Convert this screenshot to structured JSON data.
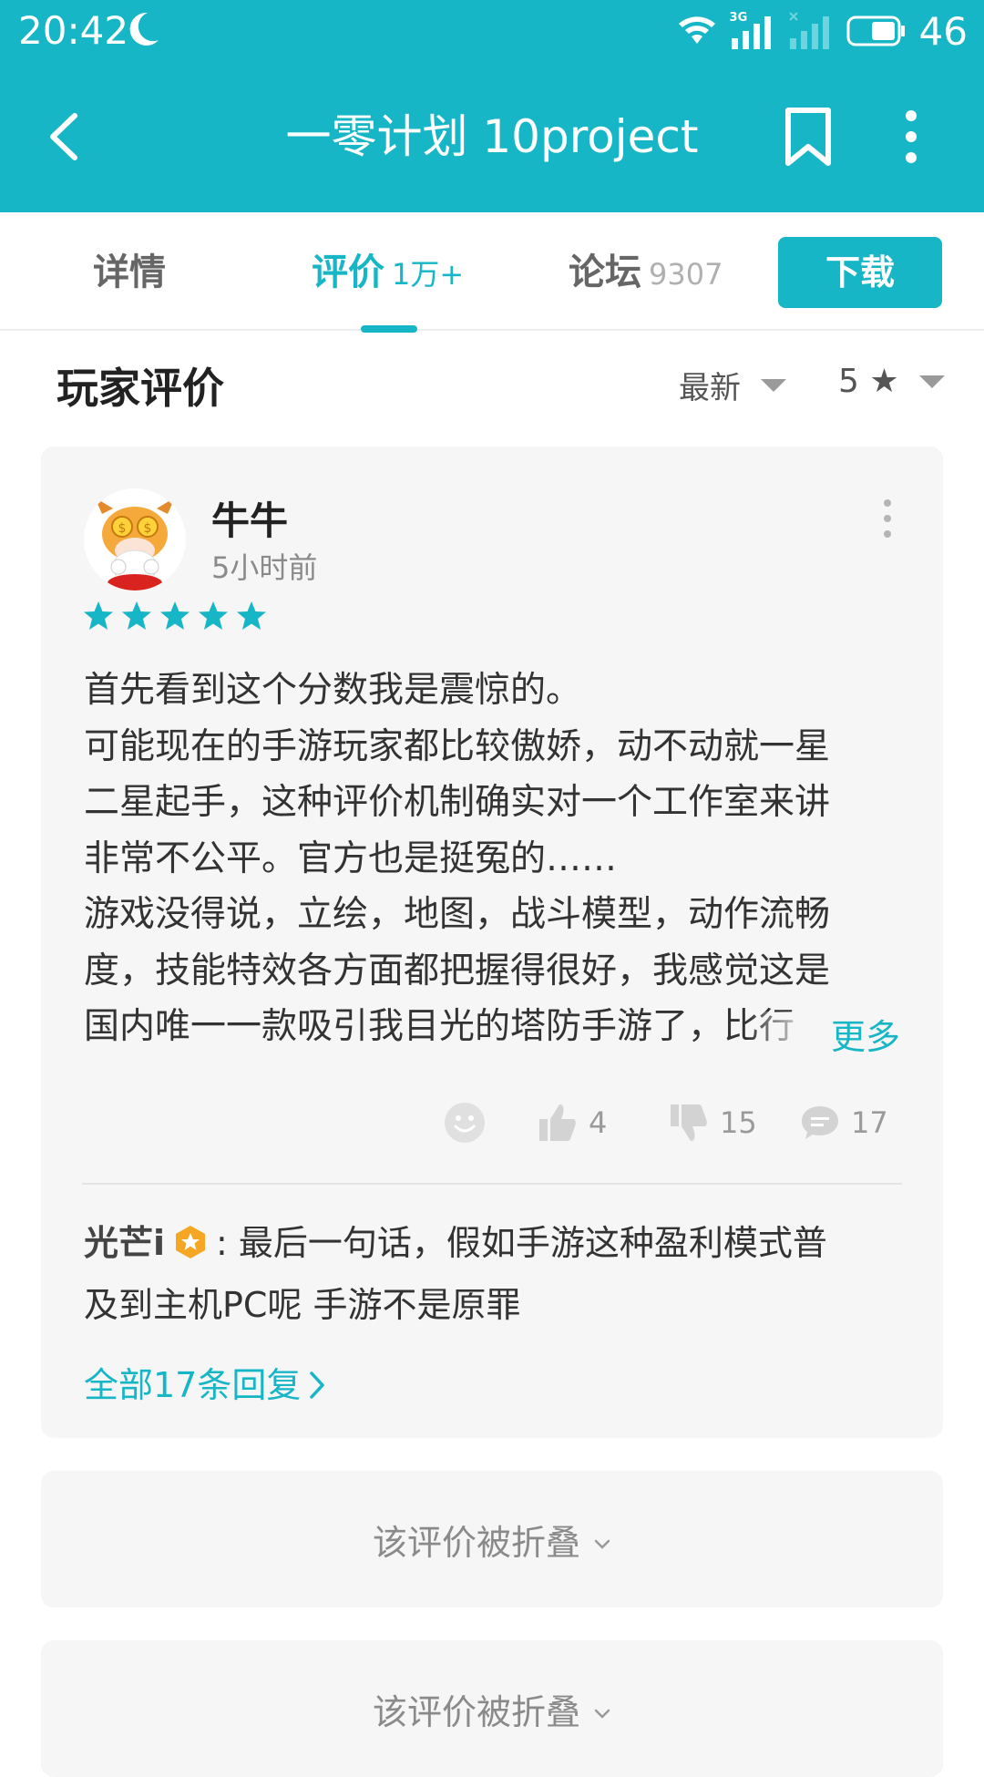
{
  "status_bar": {
    "time": "20:42",
    "network_label": "3G",
    "battery": "46"
  },
  "header": {
    "title": "一零计划 10project"
  },
  "tabs": [
    {
      "label": "详情",
      "count": ""
    },
    {
      "label": "评价",
      "count": "1万+"
    },
    {
      "label": "论坛",
      "count": "9307"
    }
  ],
  "download_label": "下载",
  "section": {
    "title": "玩家评价",
    "sort": "最新",
    "star_filter": "5 ★"
  },
  "review": {
    "username": "牛牛",
    "time_ago": "5小时前",
    "rating": 5,
    "lines": [
      "首先看到这个分数我是震惊的。",
      "可能现在的手游玩家都比较傲娇，动不动就一星",
      "二星起手，这种评价机制确实对一个工作室来讲",
      "非常不公平。官方也是挺冤的……",
      "游戏没得说，立绘，地图，战斗模型，动作流畅",
      "度，技能特效各方面都把握得很好，我感觉这是",
      "国内唯一一款吸引我目光的塔防手游了，比行"
    ],
    "more_label": "更多",
    "likes": "4",
    "dislikes": "15",
    "comments": "17"
  },
  "reply": {
    "name": "光芒i",
    "text": ": 最后一句话，假如手游这种盈利模式普",
    "text2": "及到主机PC呢 手游不是原罪",
    "all_replies": "全部17条回复"
  },
  "folded": [
    {
      "label": "该评价被折叠"
    },
    {
      "label": "该评价被折叠"
    }
  ],
  "colors": {
    "accent": "#17b6c6",
    "card_bg": "#f6f6f6"
  }
}
